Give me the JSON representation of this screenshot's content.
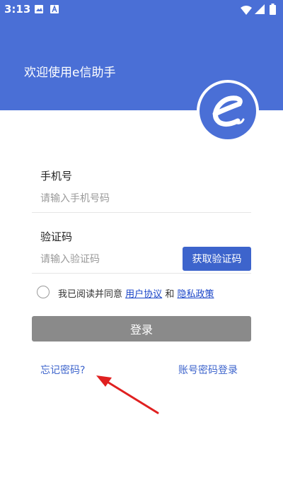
{
  "status_bar": {
    "time": "3:13",
    "left_icons": [
      "image-icon",
      "text-a-icon"
    ],
    "right_icons": [
      "wifi-icon",
      "signal-icon",
      "battery-icon"
    ]
  },
  "header": {
    "welcome_text": "欢迎使用e信助手",
    "logo_icon": "e-logo-icon",
    "background_color": "#4a6fd6"
  },
  "form": {
    "phone": {
      "label": "手机号",
      "placeholder": "请输入手机号码",
      "value": ""
    },
    "code": {
      "label": "验证码",
      "placeholder": "请输入验证码",
      "value": "",
      "button_label": "获取验证码"
    },
    "agreement": {
      "checked": false,
      "prefix": "我已阅读并同意",
      "user_agreement": "用户协议",
      "conjunction": "和",
      "privacy_policy": "隐私政策"
    },
    "login_button": "登录"
  },
  "footer": {
    "forgot_password": "忘记密码?",
    "account_login": "账号密码登录"
  },
  "colors": {
    "accent": "#3d64cc",
    "login_button_disabled": "#8a8a8a",
    "annotation_arrow": "#e02020"
  }
}
